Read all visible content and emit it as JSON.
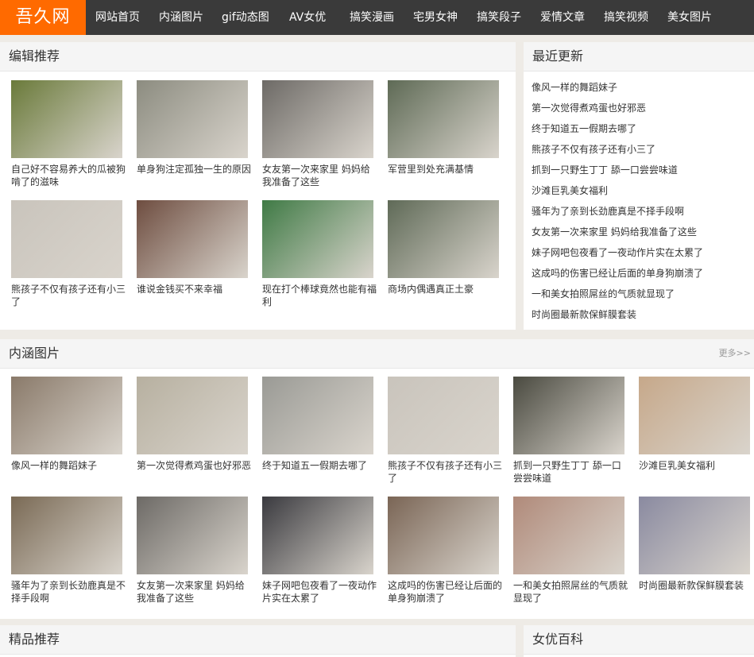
{
  "header": {
    "logo": "吾久网",
    "nav": [
      "网站首页",
      "内涵图片",
      "gif动态图",
      "AV女优",
      "搞笑漫画",
      "宅男女神",
      "搞笑段子",
      "爱情文章",
      "搞笑视频",
      "美女图片"
    ]
  },
  "editor": {
    "title": "编辑推荐",
    "items": [
      {
        "caption": "自己好不容易养大的瓜被狗啃了的滋味",
        "image": "watermelon-in-hand",
        "bg": "#6a7a3a"
      },
      {
        "caption": "单身狗注定孤独一生的原因",
        "image": "tent-scene",
        "bg": "#8c8c80"
      },
      {
        "caption": "女友第一次来家里 妈妈给我准备了这些",
        "image": "pill-pack",
        "bg": "#6d6a66"
      },
      {
        "caption": "军营里到处充满基情",
        "image": "soldiers-kiss",
        "bg": "#5e6a55"
      },
      {
        "caption": "熊孩子不仅有孩子还有小三了",
        "image": "newspaper-clip",
        "bg": "#c9c4bc"
      },
      {
        "caption": "谁说金钱买不来幸福",
        "image": "crowd-room",
        "bg": "#6e4d40"
      },
      {
        "caption": "现在打个棒球竟然也能有福利",
        "image": "baseball-pitch",
        "bg": "#3f7a45"
      },
      {
        "caption": "商场内偶遇真正土豪",
        "image": "money-stack",
        "bg": "#5f6a57"
      }
    ]
  },
  "recent": {
    "title": "最近更新",
    "items": [
      "像风一样的舞蹈妹子",
      "第一次觉得煮鸡蛋也好邪恶",
      "终于知道五一假期去哪了",
      "熊孩子不仅有孩子还有小三了",
      "抓到一只野生丁丁 舔一口尝尝味道",
      "沙滩巨乳美女福利",
      "骚年为了亲到长劲鹿真是不择手段啊",
      "女友第一次来家里 妈妈给我准备了这些",
      "妹子网吧包夜看了一夜动作片实在太累了",
      "这成吗的伤害已经让后面的单身狗崩溃了",
      "一和美女拍照屌丝的气质就显现了",
      "时尚圈最新款保鲜膜套装"
    ]
  },
  "neihan": {
    "title": "内涵图片",
    "more": "更多>>",
    "items": [
      {
        "caption": "像风一样的舞蹈妹子",
        "image": "dancing-girls",
        "bg": "#8a7a6a"
      },
      {
        "caption": "第一次觉得煮鸡蛋也好邪恶",
        "image": "boiled-egg",
        "bg": "#b7b0a0"
      },
      {
        "caption": "终于知道五一假期去哪了",
        "image": "half-price-poster",
        "bg": "#9a9a95"
      },
      {
        "caption": "熊孩子不仅有孩子还有小三了",
        "image": "newspaper-clip",
        "bg": "#c9c4bc"
      },
      {
        "caption": "抓到一只野生丁丁 舔一口尝尝味道",
        "image": "red-glove-hand",
        "bg": "#4a4a40"
      },
      {
        "caption": "沙滩巨乳美女福利",
        "image": "beach-girls",
        "bg": "#c6a88a"
      },
      {
        "caption": "骚年为了亲到长劲鹿真是不择手段啊",
        "image": "giraffe-lick",
        "bg": "#7a6a55"
      },
      {
        "caption": "女友第一次来家里 妈妈给我准备了这些",
        "image": "pill-pack",
        "bg": "#6d6a66"
      },
      {
        "caption": "妹子网吧包夜看了一夜动作片实在太累了",
        "image": "internet-cafe",
        "bg": "#3a3a3f"
      },
      {
        "caption": "这成吗的伤害已经让后面的单身狗崩溃了",
        "image": "kissing-fans",
        "bg": "#7a6555"
      },
      {
        "caption": "一和美女拍照屌丝的气质就显现了",
        "image": "group-photo",
        "bg": "#b08a7a"
      },
      {
        "caption": "时尚圈最新款保鲜膜套装",
        "image": "umbrella-couple",
        "bg": "#8a8aa0"
      }
    ]
  },
  "bottom": {
    "left_title": "精品推荐",
    "right_title": "女优百科"
  }
}
